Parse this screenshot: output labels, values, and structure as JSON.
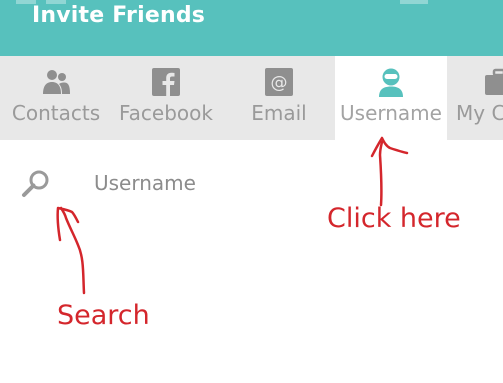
{
  "header": {
    "title": "Invite Friends"
  },
  "tabs": [
    {
      "label": "Contacts",
      "icon": "contacts-icon",
      "active": false
    },
    {
      "label": "Facebook",
      "icon": "facebook-icon",
      "active": false
    },
    {
      "label": "Email",
      "icon": "email-icon",
      "active": false
    },
    {
      "label": "Username",
      "icon": "user-avatar-icon",
      "active": true
    },
    {
      "label": "My C",
      "icon": "briefcase-icon",
      "active": false
    }
  ],
  "search": {
    "placeholder": "Username",
    "value": ""
  },
  "annotations": {
    "click_here": "Click here",
    "search": "Search"
  },
  "colors": {
    "accent": "#57c1bd",
    "tab_bar_bg": "#e8e8e8",
    "tab_text": "#9a9a9a",
    "annotation_red": "#d4262c"
  }
}
